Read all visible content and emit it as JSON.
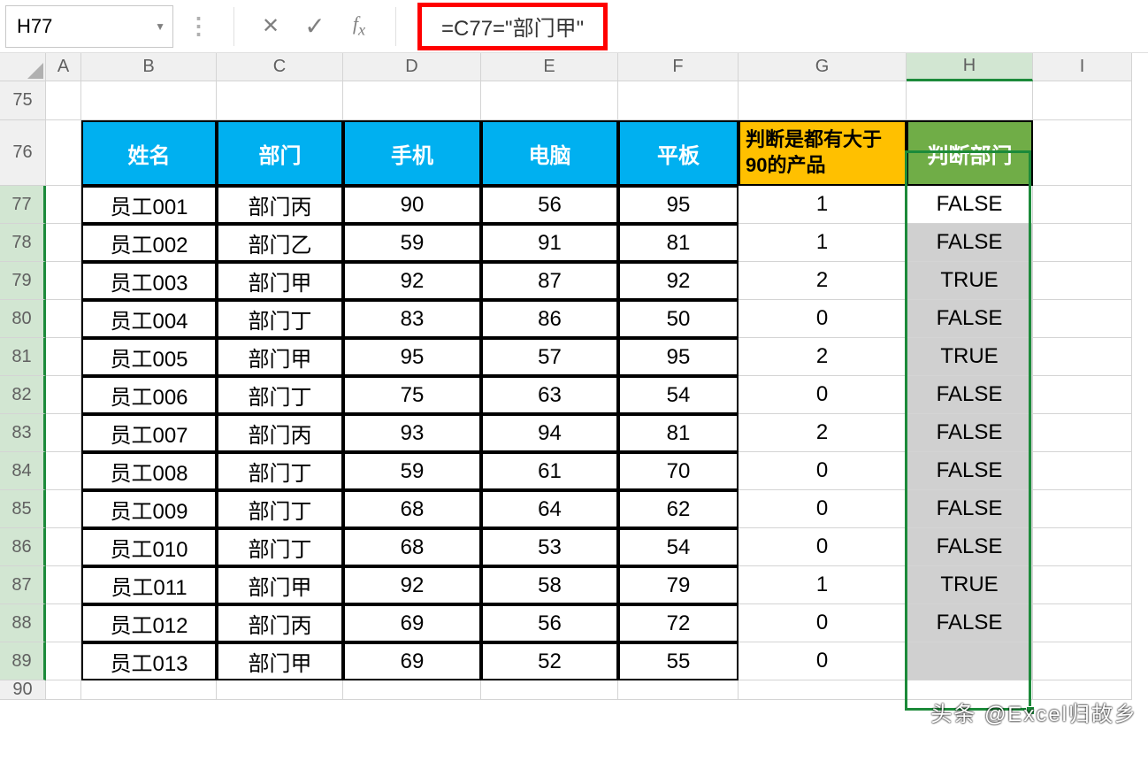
{
  "namebox": {
    "value": "H77"
  },
  "formula": {
    "value": "=C77=\"部门甲\""
  },
  "columns": [
    "A",
    "B",
    "C",
    "D",
    "E",
    "F",
    "G",
    "H",
    "I"
  ],
  "row_numbers": [
    75,
    76,
    77,
    78,
    79,
    80,
    81,
    82,
    83,
    84,
    85,
    86,
    87,
    88,
    89,
    90
  ],
  "active_column": "H",
  "headers": {
    "name": "姓名",
    "dept": "部门",
    "phone": "手机",
    "computer": "电脑",
    "tablet": "平板",
    "g_label": "判断是都有大于90的产品",
    "h_label": "判断部门"
  },
  "rows": [
    {
      "name": "员工001",
      "dept": "部门丙",
      "phone": 90,
      "computer": 56,
      "tablet": 95,
      "g": 1,
      "h": "FALSE"
    },
    {
      "name": "员工002",
      "dept": "部门乙",
      "phone": 59,
      "computer": 91,
      "tablet": 81,
      "g": 1,
      "h": "FALSE"
    },
    {
      "name": "员工003",
      "dept": "部门甲",
      "phone": 92,
      "computer": 87,
      "tablet": 92,
      "g": 2,
      "h": "TRUE"
    },
    {
      "name": "员工004",
      "dept": "部门丁",
      "phone": 83,
      "computer": 86,
      "tablet": 50,
      "g": 0,
      "h": "FALSE"
    },
    {
      "name": "员工005",
      "dept": "部门甲",
      "phone": 95,
      "computer": 57,
      "tablet": 95,
      "g": 2,
      "h": "TRUE"
    },
    {
      "name": "员工006",
      "dept": "部门丁",
      "phone": 75,
      "computer": 63,
      "tablet": 54,
      "g": 0,
      "h": "FALSE"
    },
    {
      "name": "员工007",
      "dept": "部门丙",
      "phone": 93,
      "computer": 94,
      "tablet": 81,
      "g": 2,
      "h": "FALSE"
    },
    {
      "name": "员工008",
      "dept": "部门丁",
      "phone": 59,
      "computer": 61,
      "tablet": 70,
      "g": 0,
      "h": "FALSE"
    },
    {
      "name": "员工009",
      "dept": "部门丁",
      "phone": 68,
      "computer": 64,
      "tablet": 62,
      "g": 0,
      "h": "FALSE"
    },
    {
      "name": "员工010",
      "dept": "部门丁",
      "phone": 68,
      "computer": 53,
      "tablet": 54,
      "g": 0,
      "h": "FALSE"
    },
    {
      "name": "员工011",
      "dept": "部门甲",
      "phone": 92,
      "computer": 58,
      "tablet": 79,
      "g": 1,
      "h": "TRUE"
    },
    {
      "name": "员工012",
      "dept": "部门丙",
      "phone": 69,
      "computer": 56,
      "tablet": 72,
      "g": 0,
      "h": "FALSE"
    },
    {
      "name": "员工013",
      "dept": "部门甲",
      "phone": 69,
      "computer": 52,
      "tablet": 55,
      "g": 0,
      "h": ""
    }
  ],
  "watermark": "头条 @Excel归故乡"
}
